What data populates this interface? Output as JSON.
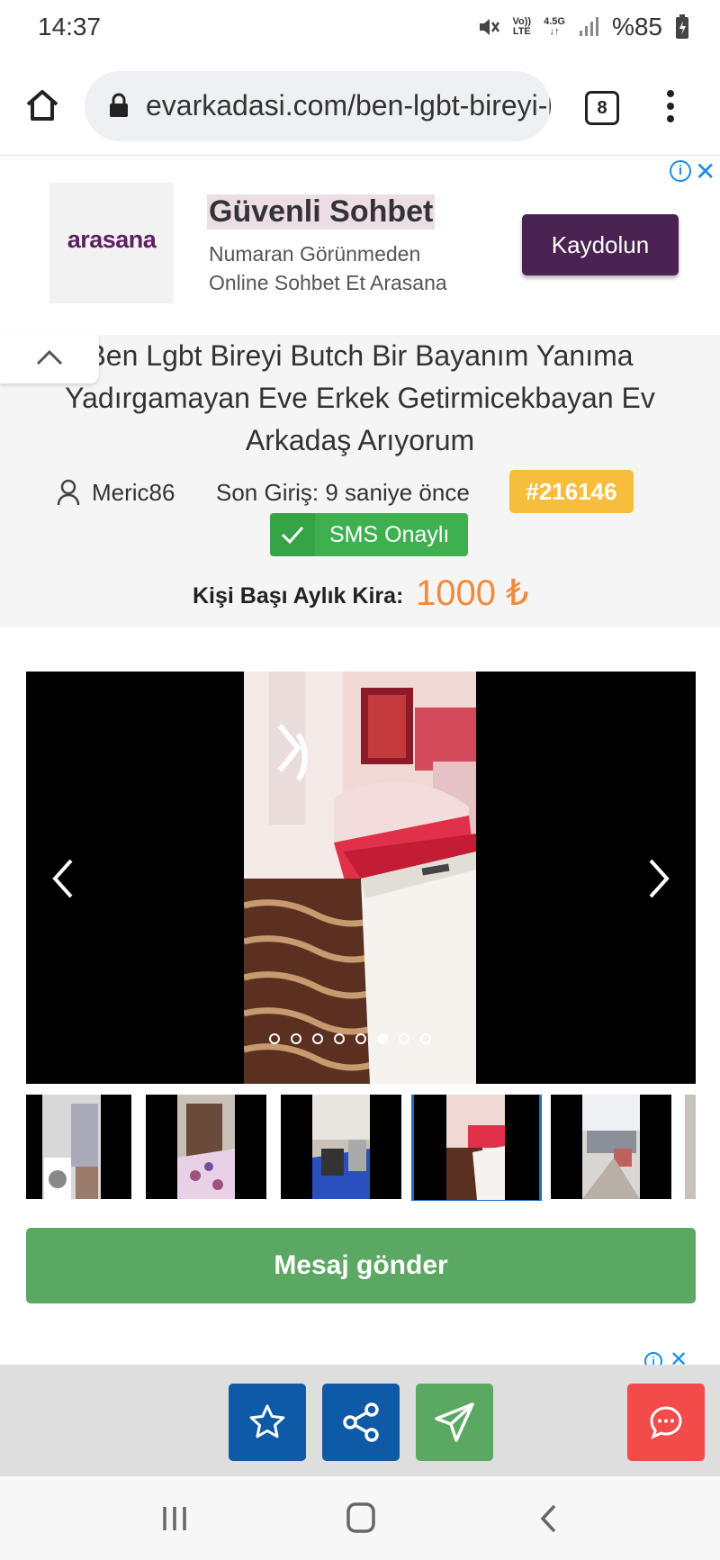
{
  "status_bar": {
    "time": "14:37",
    "volte": "Vo))",
    "lte": "LTE",
    "network": "4.5G",
    "battery": "%85"
  },
  "browser": {
    "url": "evarkadasi.com/ben-lgbt-bireyi-butch-bir-bayanim",
    "tab_count": "8"
  },
  "ad": {
    "logo_text": "arasana",
    "title": "Güvenli Sohbet",
    "description": "Numaran Görünmeden Online Sohbet Et Arasana",
    "cta": "Kaydolun"
  },
  "listing": {
    "title": "Ben Lgbt Bireyi Butch Bir Bayanım Yanıma Yadırgamayan Eve Erkek Getirmicekbayan Ev Arkadaş Arıyorum",
    "username": "Meric86",
    "last_login": "Son Giriş: 9 saniye önce",
    "listing_id": "#216146",
    "sms_badge": "SMS Onaylı",
    "rent_label": "Kişi Başı Aylık Kira:",
    "rent_value": "1000 ₺"
  },
  "gallery": {
    "photo_count": 8,
    "active_index": 5
  },
  "actions": {
    "send_message": "Mesaj gönder"
  },
  "colors": {
    "favorite": "#0e5aa7",
    "share": "#0e5aa7",
    "send": "#5aa862",
    "chat": "#f34a4a",
    "badge": "#f7be3e",
    "sms": "#3fb050",
    "rent": "#f08a3c"
  }
}
